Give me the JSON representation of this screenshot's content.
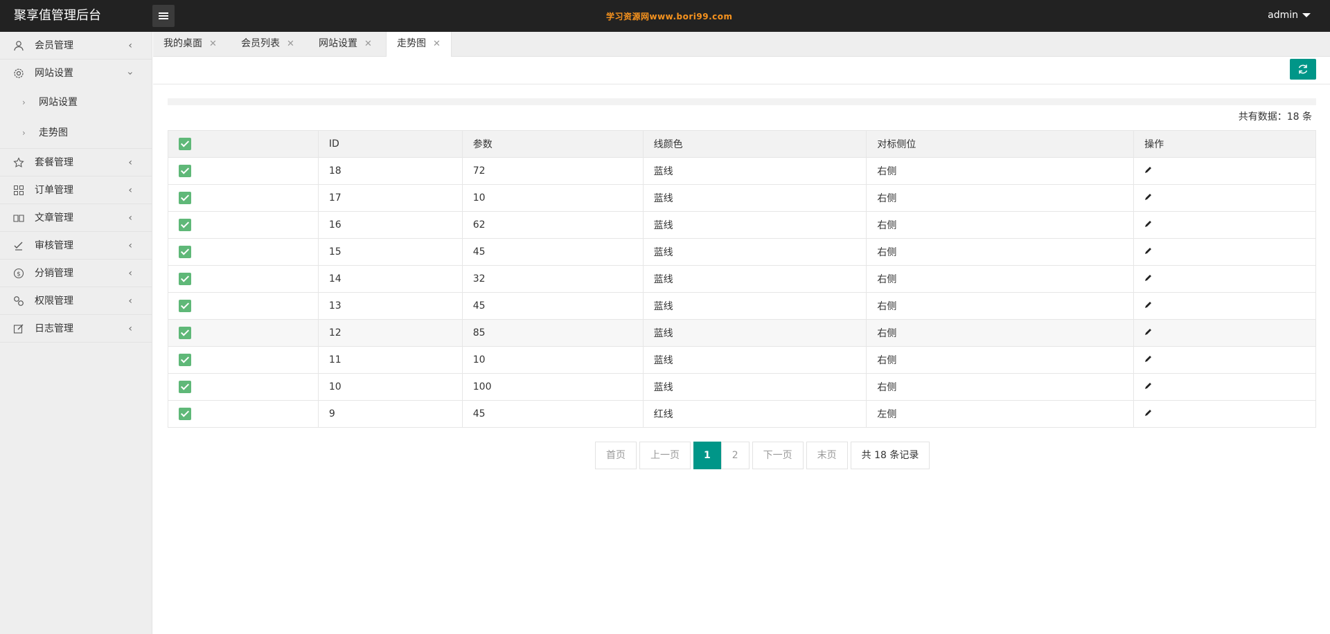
{
  "header": {
    "title": "聚享值管理后台",
    "watermark": "学习资源网www.bori99.com",
    "user": "admin"
  },
  "sidebar": {
    "items": [
      {
        "label": "会员管理",
        "icon": "user-icon"
      },
      {
        "label": "网站设置",
        "icon": "gear-icon",
        "expanded": true,
        "children": [
          {
            "label": "网站设置"
          },
          {
            "label": "走势图"
          }
        ]
      },
      {
        "label": "套餐管理",
        "icon": "star-icon"
      },
      {
        "label": "订单管理",
        "icon": "grid-icon"
      },
      {
        "label": "文章管理",
        "icon": "book-icon"
      },
      {
        "label": "审核管理",
        "icon": "approve-icon"
      },
      {
        "label": "分销管理",
        "icon": "dollar-icon"
      },
      {
        "label": "权限管理",
        "icon": "link-icon"
      },
      {
        "label": "日志管理",
        "icon": "edit-icon"
      }
    ]
  },
  "tabs": [
    {
      "label": "我的桌面"
    },
    {
      "label": "会员列表"
    },
    {
      "label": "网站设置"
    },
    {
      "label": "走势图",
      "active": true
    }
  ],
  "toolbar": {
    "refresh_icon": "refresh-icon"
  },
  "summary": {
    "total_label": "共有数据：18 条"
  },
  "table": {
    "columns": [
      "ID",
      "参数",
      "线颜色",
      "对标侧位",
      "操作"
    ],
    "rows": [
      {
        "id": "18",
        "param": "72",
        "color": "蓝线",
        "side": "右侧"
      },
      {
        "id": "17",
        "param": "10",
        "color": "蓝线",
        "side": "右侧"
      },
      {
        "id": "16",
        "param": "62",
        "color": "蓝线",
        "side": "右侧"
      },
      {
        "id": "15",
        "param": "45",
        "color": "蓝线",
        "side": "右侧"
      },
      {
        "id": "14",
        "param": "32",
        "color": "蓝线",
        "side": "右侧"
      },
      {
        "id": "13",
        "param": "45",
        "color": "蓝线",
        "side": "右侧"
      },
      {
        "id": "12",
        "param": "85",
        "color": "蓝线",
        "side": "右侧"
      },
      {
        "id": "11",
        "param": "10",
        "color": "蓝线",
        "side": "右侧"
      },
      {
        "id": "10",
        "param": "100",
        "color": "蓝线",
        "side": "右侧"
      },
      {
        "id": "9",
        "param": "45",
        "color": "红线",
        "side": "左侧"
      }
    ]
  },
  "pagination": {
    "first": "首页",
    "prev": "上一页",
    "pages": [
      "1",
      "2"
    ],
    "current": "1",
    "next": "下一页",
    "last": "末页",
    "info": "共 18 条记录"
  },
  "colors": {
    "accent": "#009688",
    "checkbox": "#5fb878",
    "header_bg": "#222222",
    "watermark": "#f7931e"
  }
}
